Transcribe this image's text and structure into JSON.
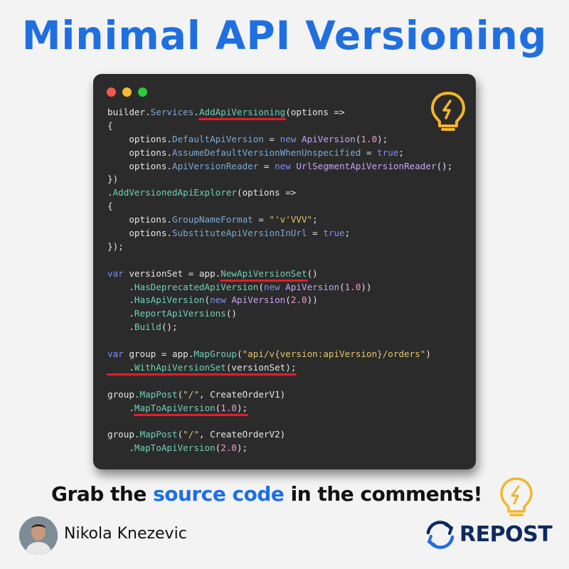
{
  "header": {
    "title": "Minimal API Versioning"
  },
  "code": {
    "l1": [
      "builder.",
      "Services",
      ".",
      "AddApiVersioning",
      "(options =>"
    ],
    "l2": [
      "{"
    ],
    "l3": [
      "    options.",
      "DefaultApiVersion",
      " = ",
      "new",
      " ",
      "ApiVersion",
      "(",
      "1.0",
      ");"
    ],
    "l4": [
      "    options.",
      "AssumeDefaultVersionWhenUnspecified",
      " = ",
      "true",
      ";"
    ],
    "l5": [
      "    options.",
      "ApiVersionReader",
      " = ",
      "new",
      " ",
      "UrlSegmentApiVersionReader",
      "();"
    ],
    "l6": [
      "})"
    ],
    "l7": [
      ".",
      "AddVersionedApiExplorer",
      "(options =>"
    ],
    "l8": [
      "{"
    ],
    "l9": [
      "    options.",
      "GroupNameFormat",
      " = ",
      "\"'v'VVV\"",
      ";"
    ],
    "l10": [
      "    options.",
      "SubstituteApiVersionInUrl",
      " = ",
      "true",
      ";"
    ],
    "l11": [
      "});"
    ],
    "l13": [
      "var",
      " versionSet = app.",
      "NewApiVersionSet",
      "()"
    ],
    "l14": [
      "    .",
      "HasDeprecatedApiVersion",
      "(",
      "new",
      " ",
      "ApiVersion",
      "(",
      "1.0",
      "))"
    ],
    "l15": [
      "    .",
      "HasApiVersion",
      "(",
      "new",
      " ",
      "ApiVersion",
      "(",
      "2.0",
      "))"
    ],
    "l16": [
      "    .",
      "ReportApiVersions",
      "()"
    ],
    "l17": [
      "    .",
      "Build",
      "();"
    ],
    "l19": [
      "var",
      " group = app.",
      "MapGroup",
      "(",
      "\"api/v{version:apiVersion}/orders\"",
      ")"
    ],
    "l20": [
      "    .",
      "WithApiVersionSet",
      "(versionSet);"
    ],
    "l22": [
      "group.",
      "MapPost",
      "(",
      "\"/\"",
      ", CreateOrderV1)"
    ],
    "l23": [
      "    .",
      "MapToApiVersion",
      "(",
      "1.0",
      ");"
    ],
    "l25": [
      "group.",
      "MapPost",
      "(",
      "\"/\"",
      ", CreateOrderV2)"
    ],
    "l26": [
      "    .",
      "MapToApiVersion",
      "(",
      "2.0",
      ");"
    ]
  },
  "cta": {
    "prefix": "Grab the ",
    "highlight": "source code",
    "suffix": " in the comments!"
  },
  "footer": {
    "author": "Nikola Knezevic",
    "repost_label": "REPOST"
  },
  "icons": {
    "window_controls": [
      "close-dot",
      "minimize-dot",
      "maximize-dot"
    ],
    "code_bulb": "lightbulb-icon",
    "cta_bulb": "lightbulb-icon",
    "avatar": "author-avatar",
    "repost": "repost-icon"
  },
  "colors": {
    "title_blue": "#1f6fe0",
    "underline_red": "#e41d2c",
    "window_bg": "#2b2b2b",
    "repost_navy": "#0e2a5e",
    "bulb_yellow": "#f2b62b"
  }
}
